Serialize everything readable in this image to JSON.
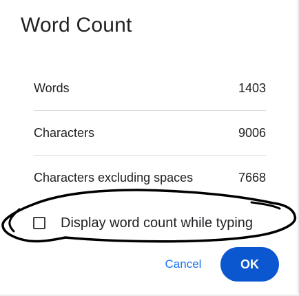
{
  "dialog": {
    "title": "Word Count"
  },
  "stats": [
    {
      "label": "Words",
      "value": "1403"
    },
    {
      "label": "Characters",
      "value": "9006"
    },
    {
      "label": "Characters excluding spaces",
      "value": "7668"
    }
  ],
  "option": {
    "label": "Display word count while typing",
    "checked": false
  },
  "buttons": {
    "cancel": "Cancel",
    "ok": "OK"
  },
  "colors": {
    "accent": "#0b57d0",
    "link": "#1a73e8",
    "divider": "#dadce0",
    "text": "#202124"
  }
}
